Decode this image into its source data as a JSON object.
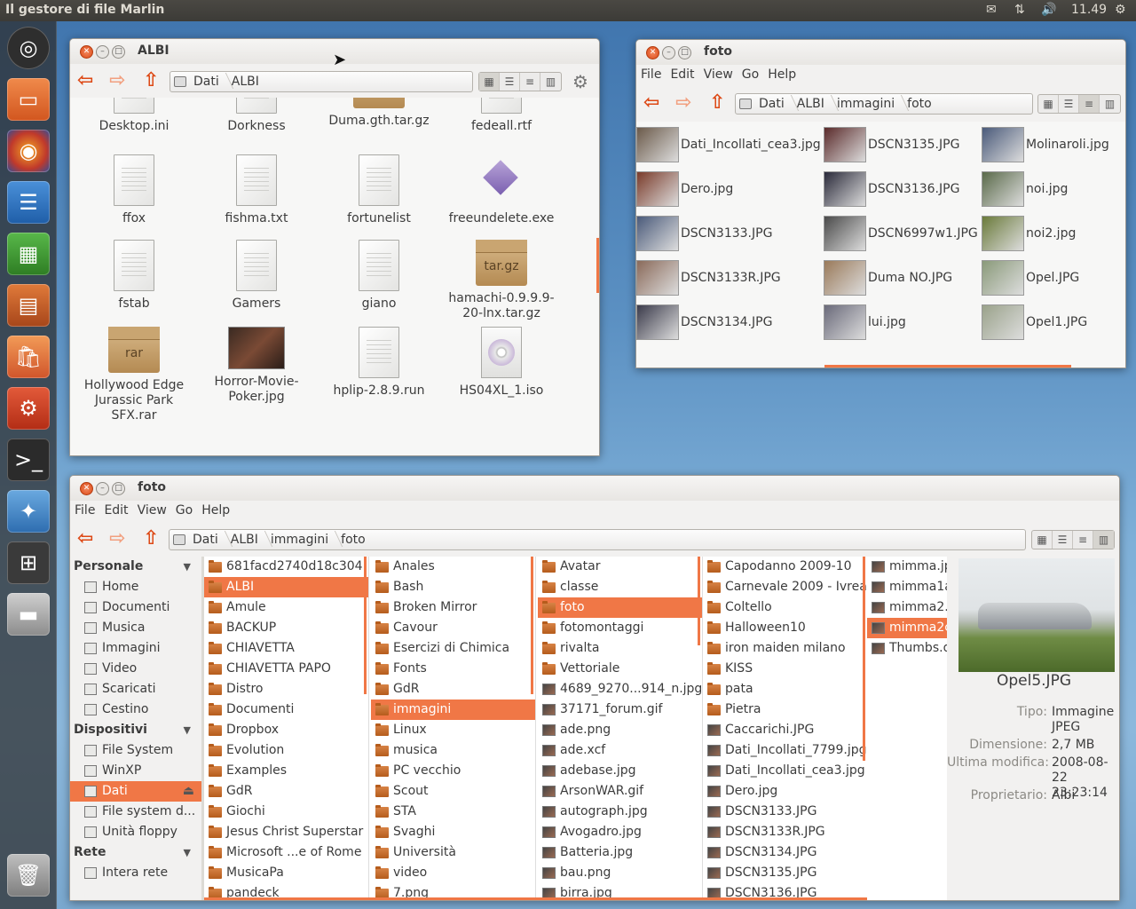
{
  "top_panel": {
    "app_title": "Il gestore di file Marlin",
    "clock": "11.49"
  },
  "launcher": {
    "items": [
      "ubuntu-logo",
      "files",
      "firefox",
      "writer",
      "calc",
      "impress",
      "software-center",
      "settings",
      "terminal",
      "marlin",
      "workspaces",
      "drive",
      "trash"
    ]
  },
  "win_albi": {
    "title": "ALBI",
    "breadcrumb": [
      "Dati",
      "ALBI"
    ],
    "files": [
      {
        "name": "Desktop.ini",
        "kind": "text"
      },
      {
        "name": "Dorkness",
        "kind": "text"
      },
      {
        "name": "Duma.gth.tar.gz",
        "kind": "archive",
        "badge": "tar.gz"
      },
      {
        "name": "fedeall.rtf",
        "kind": "text"
      },
      {
        "name": "ffox",
        "kind": "text"
      },
      {
        "name": "fishma.txt",
        "kind": "text"
      },
      {
        "name": "fortunelist",
        "kind": "text"
      },
      {
        "name": "freeundelete.exe",
        "kind": "exe"
      },
      {
        "name": "fstab",
        "kind": "text"
      },
      {
        "name": "Gamers",
        "kind": "text"
      },
      {
        "name": "giano",
        "kind": "text"
      },
      {
        "name": "hamachi-0.9.9.9-20-lnx.tar.gz",
        "kind": "archive",
        "badge": "tar.gz"
      },
      {
        "name": "Hollywood Edge Jurassic Park SFX.rar",
        "kind": "archive",
        "badge": "rar"
      },
      {
        "name": "Horror-Movie-Poker.jpg",
        "kind": "image"
      },
      {
        "name": "hplip-2.8.9.run",
        "kind": "text"
      },
      {
        "name": "HS04XL_1.iso",
        "kind": "iso"
      }
    ]
  },
  "win_foto_top": {
    "title": "foto",
    "menu": [
      "File",
      "Edit",
      "View",
      "Go",
      "Help"
    ],
    "breadcrumb": [
      "Dati",
      "ALBI",
      "immagini",
      "foto"
    ],
    "files": [
      "Dati_Incollati_cea3.jpg",
      "Dero.jpg",
      "DSCN3133.JPG",
      "DSCN3133R.JPG",
      "DSCN3134.JPG",
      "DSCN3135.JPG",
      "DSCN3136.JPG",
      "DSCN6997w1.JPG",
      "Duma NO.JPG",
      "lui.jpg",
      "Molinaroli.jpg",
      "noi.jpg",
      "noi2.jpg",
      "Opel.JPG",
      "Opel1.JPG"
    ]
  },
  "win_foto_bottom": {
    "title": "foto",
    "menu": [
      "File",
      "Edit",
      "View",
      "Go",
      "Help"
    ],
    "breadcrumb": [
      "Dati",
      "ALBI",
      "immagini",
      "foto"
    ],
    "sidebar": {
      "sections": [
        {
          "title": "Personale",
          "items": [
            "Home",
            "Documenti",
            "Musica",
            "Immagini",
            "Video",
            "Scaricati",
            "Cestino"
          ]
        },
        {
          "title": "Dispositivi",
          "items": [
            "File System",
            "WinXP",
            "Dati",
            "File system d...",
            "Unità floppy"
          ]
        },
        {
          "title": "Rete",
          "items": [
            "Intera rete"
          ]
        }
      ],
      "selected": "Dati"
    },
    "col1": {
      "items": [
        "681facd2740d18c304",
        "ALBI",
        "Amule",
        "BACKUP",
        "CHIAVETTA",
        "CHIAVETTA PAPO",
        "Distro",
        "Documenti",
        "Dropbox",
        "Evolution",
        "Examples",
        "GdR",
        "Giochi",
        "Jesus Christ Superstar",
        "Microsoft ...e of Rome",
        "MusicaPa",
        "pandeck"
      ],
      "selected": "ALBI"
    },
    "col2": {
      "items": [
        "Anales",
        "Bash",
        "Broken Mirror",
        "Cavour",
        "Esercizi di Chimica",
        "Fonts",
        "GdR",
        "immagini",
        "Linux",
        "musica",
        "PC vecchio",
        "Scout",
        "STA",
        "Svaghi",
        "Università",
        "video",
        "7.png"
      ],
      "selected": "immagini"
    },
    "col3": {
      "items": [
        {
          "name": "Avatar",
          "kind": "folder"
        },
        {
          "name": "classe",
          "kind": "folder"
        },
        {
          "name": "foto",
          "kind": "folder"
        },
        {
          "name": "fotomontaggi",
          "kind": "folder"
        },
        {
          "name": "rivalta",
          "kind": "folder"
        },
        {
          "name": "Vettoriale",
          "kind": "folder"
        },
        {
          "name": "4689_9270...914_n.jpg",
          "kind": "img"
        },
        {
          "name": "37171_forum.gif",
          "kind": "img"
        },
        {
          "name": "ade.png",
          "kind": "img"
        },
        {
          "name": "ade.xcf",
          "kind": "img"
        },
        {
          "name": "adebase.jpg",
          "kind": "img"
        },
        {
          "name": "ArsonWAR.gif",
          "kind": "img"
        },
        {
          "name": "autograph.jpg",
          "kind": "img"
        },
        {
          "name": "Avogadro.jpg",
          "kind": "img"
        },
        {
          "name": "Batteria.jpg",
          "kind": "img"
        },
        {
          "name": "bau.png",
          "kind": "img"
        },
        {
          "name": "birra.jpg",
          "kind": "img"
        }
      ],
      "selected": "foto"
    },
    "col4": {
      "items": [
        {
          "name": "Capodanno 2009-10",
          "kind": "folder"
        },
        {
          "name": "Carnevale 2009 - Ivrea",
          "kind": "folder"
        },
        {
          "name": "Coltello",
          "kind": "folder"
        },
        {
          "name": "Halloween10",
          "kind": "folder"
        },
        {
          "name": "iron maiden milano",
          "kind": "folder"
        },
        {
          "name": "KISS",
          "kind": "folder"
        },
        {
          "name": "pata",
          "kind": "folder"
        },
        {
          "name": "Pietra",
          "kind": "folder"
        },
        {
          "name": "Caccarichi.JPG",
          "kind": "img"
        },
        {
          "name": "Dati_Incollati_7799.jpg",
          "kind": "img"
        },
        {
          "name": "Dati_Incollati_cea3.jpg",
          "kind": "img"
        },
        {
          "name": "Dero.jpg",
          "kind": "img"
        },
        {
          "name": "DSCN3133.JPG",
          "kind": "img"
        },
        {
          "name": "DSCN3133R.JPG",
          "kind": "img"
        },
        {
          "name": "DSCN3134.JPG",
          "kind": "img"
        },
        {
          "name": "DSCN3135.JPG",
          "kind": "img"
        },
        {
          "name": "DSCN3136.JPG",
          "kind": "img"
        }
      ]
    },
    "col5": {
      "items": [
        "mimma.jp",
        "mimma1a",
        "mimma2.j",
        "mimma2c",
        "Thumbs.d"
      ],
      "selected": "mimma2c"
    },
    "preview": {
      "filename": "Opel5.JPG",
      "tipo_label": "Tipo:",
      "tipo_value": "Immagine JPEG",
      "dim_label": "Dimensione:",
      "dim_value": "2,7 MB",
      "mod_label": "Ultima modifica:",
      "mod_value": "2008-08-22 23:23:14",
      "owner_label": "Proprietario:",
      "owner_value": "Albi"
    }
  },
  "colors": {
    "accent": "#f07746",
    "arrow": "#dd4814",
    "panel": "#3c3b37"
  }
}
